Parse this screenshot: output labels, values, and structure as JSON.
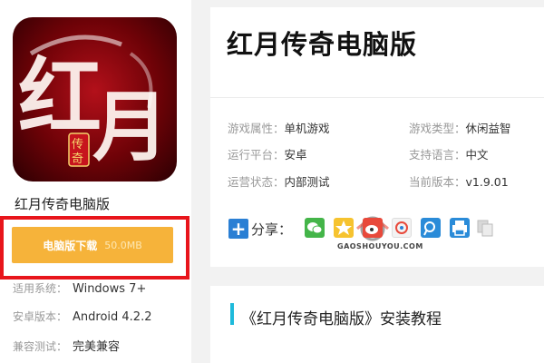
{
  "app": {
    "icon_text": "红月",
    "icon_seal": "传奇",
    "name": "红月传奇电脑版"
  },
  "download": {
    "label": "电脑版下载",
    "size": "50.0MB"
  },
  "specs": [
    {
      "key": "适用系统：",
      "value": "Windows 7+"
    },
    {
      "key": "安卓版本：",
      "value": "Android 4.2.2"
    },
    {
      "key": "兼容测试：",
      "value": "完美兼容"
    }
  ],
  "title": "红月传奇电脑版",
  "attributes": [
    {
      "key": "游戏属性：",
      "value": "单机游戏"
    },
    {
      "key": "游戏类型：",
      "value": "休闲益智"
    },
    {
      "key": "运行平台：",
      "value": "安卓"
    },
    {
      "key": "支持语言：",
      "value": "中文"
    },
    {
      "key": "运营状态：",
      "value": "内部测试"
    },
    {
      "key": "当前版本：",
      "value": "v1.9.01"
    }
  ],
  "share": {
    "label": "分享：",
    "icons": [
      "wechat-icon",
      "qzone-icon",
      "sina-weibo-icon",
      "tencent-weibo-icon",
      "print-icon",
      "copy-icon"
    ]
  },
  "watermark": "GAOSHOUYOU.COM",
  "tutorial": {
    "title": "《红月传奇电脑版》安装教程"
  },
  "colors": {
    "download_button": "#f6b33a",
    "highlight_frame": "#e8151b",
    "accent_bar": "#1ebadb",
    "share_plus": "#2a7fd4"
  }
}
